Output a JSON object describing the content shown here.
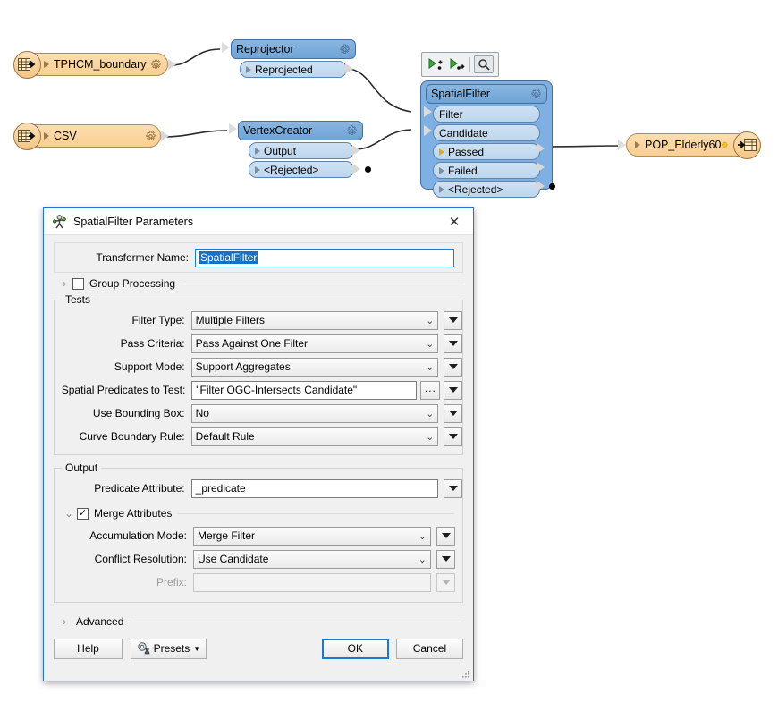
{
  "canvas": {
    "nodes": {
      "reader_boundary": {
        "label": "TPHCM_boundary",
        "icon": "table-reader-icon",
        "gear": "gear-icon"
      },
      "reader_csv": {
        "label": "CSV",
        "icon": "table-reader-icon",
        "gear": "gear-icon"
      },
      "reprojector": {
        "title": "Reprojector",
        "gear": "gear-icon",
        "ports": [
          {
            "label": "Reprojected",
            "connected": false
          }
        ]
      },
      "vertexcreator": {
        "title": "VertexCreator",
        "gear": "gear-icon",
        "ports": [
          {
            "label": "Output",
            "connected": false
          },
          {
            "label": "<Rejected>",
            "connected": false
          }
        ]
      },
      "spatialfilter": {
        "title": "SpatialFilter",
        "gear": "gear-icon",
        "selected": true,
        "ports": [
          {
            "label": "Filter",
            "connected": false
          },
          {
            "label": "Candidate",
            "connected": false
          },
          {
            "label": "Passed",
            "connected": true
          },
          {
            "label": "Failed",
            "connected": false
          },
          {
            "label": "<Rejected>",
            "connected": false
          }
        ]
      },
      "writer_pop": {
        "label": "POP_Elderly60",
        "icon": "table-writer-icon",
        "gear": "gear-icon"
      }
    },
    "mini_toolbar": {
      "buttons": [
        {
          "name": "add-breakpoint-icon",
          "title": "Run To This"
        },
        {
          "name": "run-from-here-icon",
          "title": "Run From Here"
        },
        {
          "name": "inspect-icon",
          "title": "Inspect"
        }
      ]
    }
  },
  "dialog": {
    "title": "SpatialFilter Parameters",
    "app_icon": "transformer-icon",
    "close_label": "✕",
    "transformer_name": {
      "label": "Transformer Name:",
      "value": "SpatialFilter",
      "selected": true
    },
    "group_processing": {
      "label": "Group Processing",
      "checked": false,
      "expanded": false,
      "chevron": "›"
    },
    "tests": {
      "caption": "Tests",
      "fields": [
        {
          "label": "Filter Type:",
          "value": "Multiple Filters",
          "type": "combo"
        },
        {
          "label": "Pass Criteria:",
          "value": "Pass Against One Filter",
          "type": "combo"
        },
        {
          "label": "Support Mode:",
          "value": "Support Aggregates",
          "type": "combo"
        },
        {
          "label": "Spatial Predicates to Test:",
          "value": "\"Filter OGC-Intersects Candidate\"",
          "type": "text-browse",
          "browse_label": "..."
        },
        {
          "label": "Use Bounding Box:",
          "value": "No",
          "type": "combo"
        },
        {
          "label": "Curve Boundary Rule:",
          "value": "Default Rule",
          "type": "combo"
        }
      ]
    },
    "output": {
      "caption": "Output",
      "predicate_attribute": {
        "label": "Predicate Attribute:",
        "value": "_predicate",
        "type": "text"
      },
      "merge_attributes": {
        "label": "Merge Attributes",
        "checked": true,
        "expanded": true,
        "chevron": "⌄",
        "check_mark": "✓"
      },
      "merge_fields": [
        {
          "label": "Accumulation Mode:",
          "value": "Merge Filter",
          "type": "combo",
          "disabled": false
        },
        {
          "label": "Conflict Resolution:",
          "value": "Use Candidate",
          "type": "combo",
          "disabled": false
        },
        {
          "label": "Prefix:",
          "value": "",
          "type": "text",
          "disabled": true
        }
      ]
    },
    "advanced": {
      "label": "Advanced",
      "expanded": false,
      "chevron": "›"
    },
    "footer": {
      "help_label": "Help",
      "presets_label": "Presets",
      "presets_caret": "▼",
      "ok_label": "OK",
      "cancel_label": "Cancel"
    }
  }
}
